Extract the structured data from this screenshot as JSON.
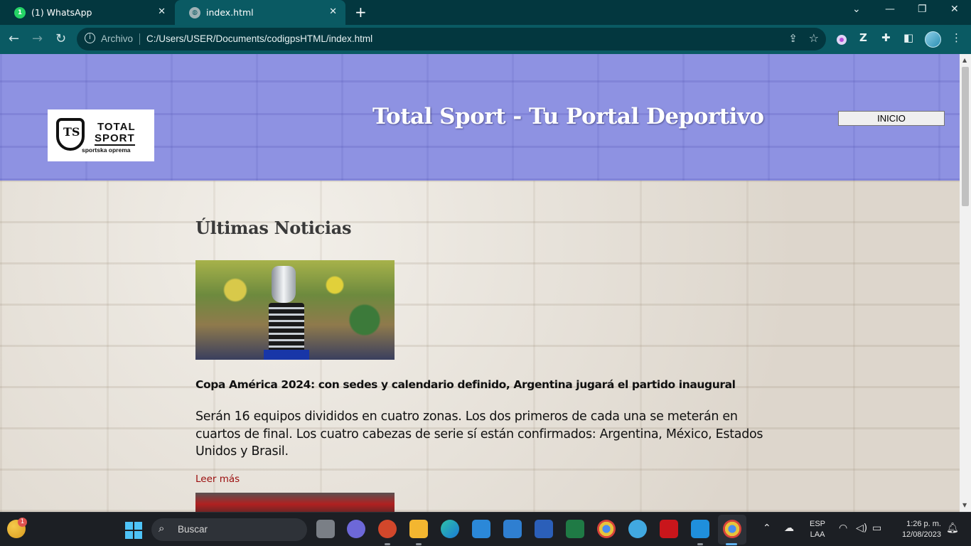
{
  "browser": {
    "tabs": [
      {
        "label": "(1) WhatsApp",
        "icon": "whatsapp-icon",
        "active": false,
        "badge": "1"
      },
      {
        "label": "index.html",
        "icon": "globe-icon",
        "active": true
      }
    ],
    "address": {
      "prefix": "Archivo",
      "url": "C:/Users/USER/Documents/codigpsHTML/index.html"
    }
  },
  "page": {
    "header": {
      "title": "Total Sport - Tu Portal Deportivo",
      "nav_button": "INICIO",
      "logo": {
        "line1": "TOTAL",
        "line2": "SPORT",
        "tagline": "sportska oprema",
        "monogram": "TS"
      }
    },
    "news": {
      "heading": "Últimas Noticias",
      "articles": [
        {
          "title": "Copa América 2024: con sedes y calendario definido, Argentina jugará el partido inaugural",
          "body": "Serán 16 equipos divididos en cuatro zonas. Los dos primeros de cada una se meterán en cuartos de final. Los cuatro cabezas de serie sí están confirmados: Argentina, México, Estados Unidos y Brasil.",
          "link": "Leer más"
        }
      ]
    }
  },
  "taskbar": {
    "search_placeholder": "Buscar",
    "weather_badge": "1",
    "language": {
      "line1": "ESP",
      "line2": "LAA"
    },
    "clock": {
      "time": "1:26 p. m.",
      "date": "12/08/2023"
    }
  },
  "colors": {
    "tabbar": "#03373f",
    "toolbar": "#0a5a63",
    "header_bg": "#8e92e2",
    "link": "#9a0c0c"
  }
}
